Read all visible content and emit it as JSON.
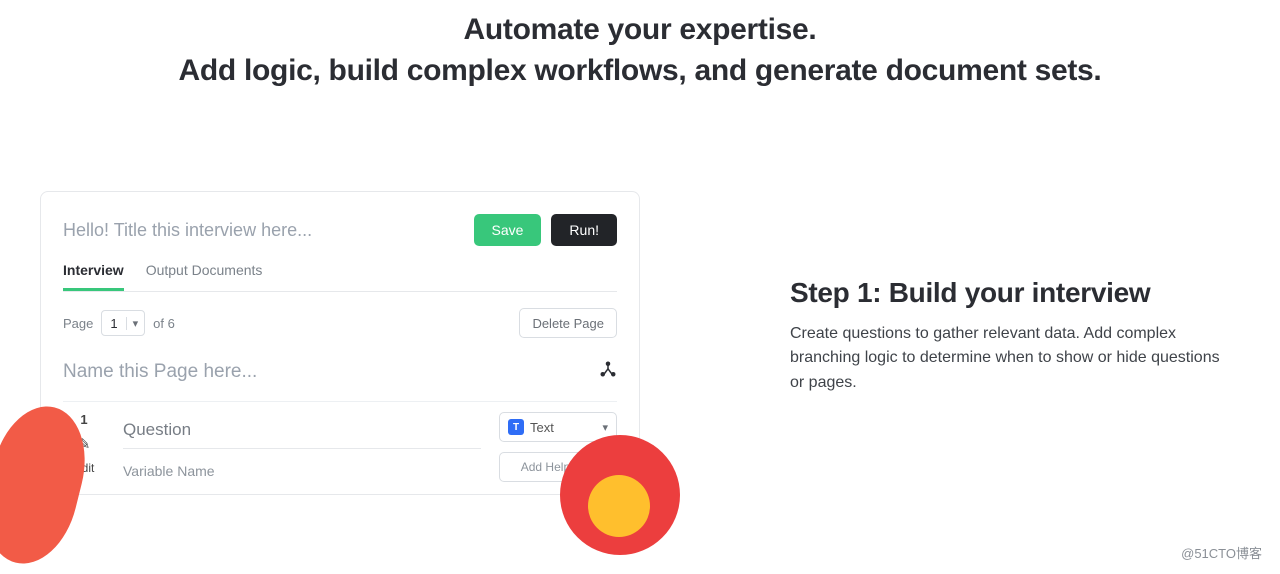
{
  "hero": {
    "line1": "Automate your expertise.",
    "line2": "Add logic, build complex workflows, and generate document sets."
  },
  "panel": {
    "title_placeholder": "Hello! Title this interview here...",
    "buttons": {
      "save": "Save",
      "run": "Run!"
    },
    "tabs": {
      "interview": "Interview",
      "output": "Output Documents"
    },
    "pagebar": {
      "label": "Page",
      "current": "1",
      "total_text": "of 6",
      "delete": "Delete Page"
    },
    "pagename_placeholder": "Name this Page here...",
    "question": {
      "index": "1",
      "edit_label": "Edit",
      "question_placeholder": "Question",
      "variable_placeholder": "Variable Name",
      "type_badge": "T",
      "type_label": "Text",
      "help_label": "Add Help Text"
    }
  },
  "step": {
    "title": "Step 1: Build your interview",
    "body": "Create questions to gather relevant data. Add complex branching logic to determine when to show or hide questions or pages."
  },
  "watermark": "@51CTO博客"
}
